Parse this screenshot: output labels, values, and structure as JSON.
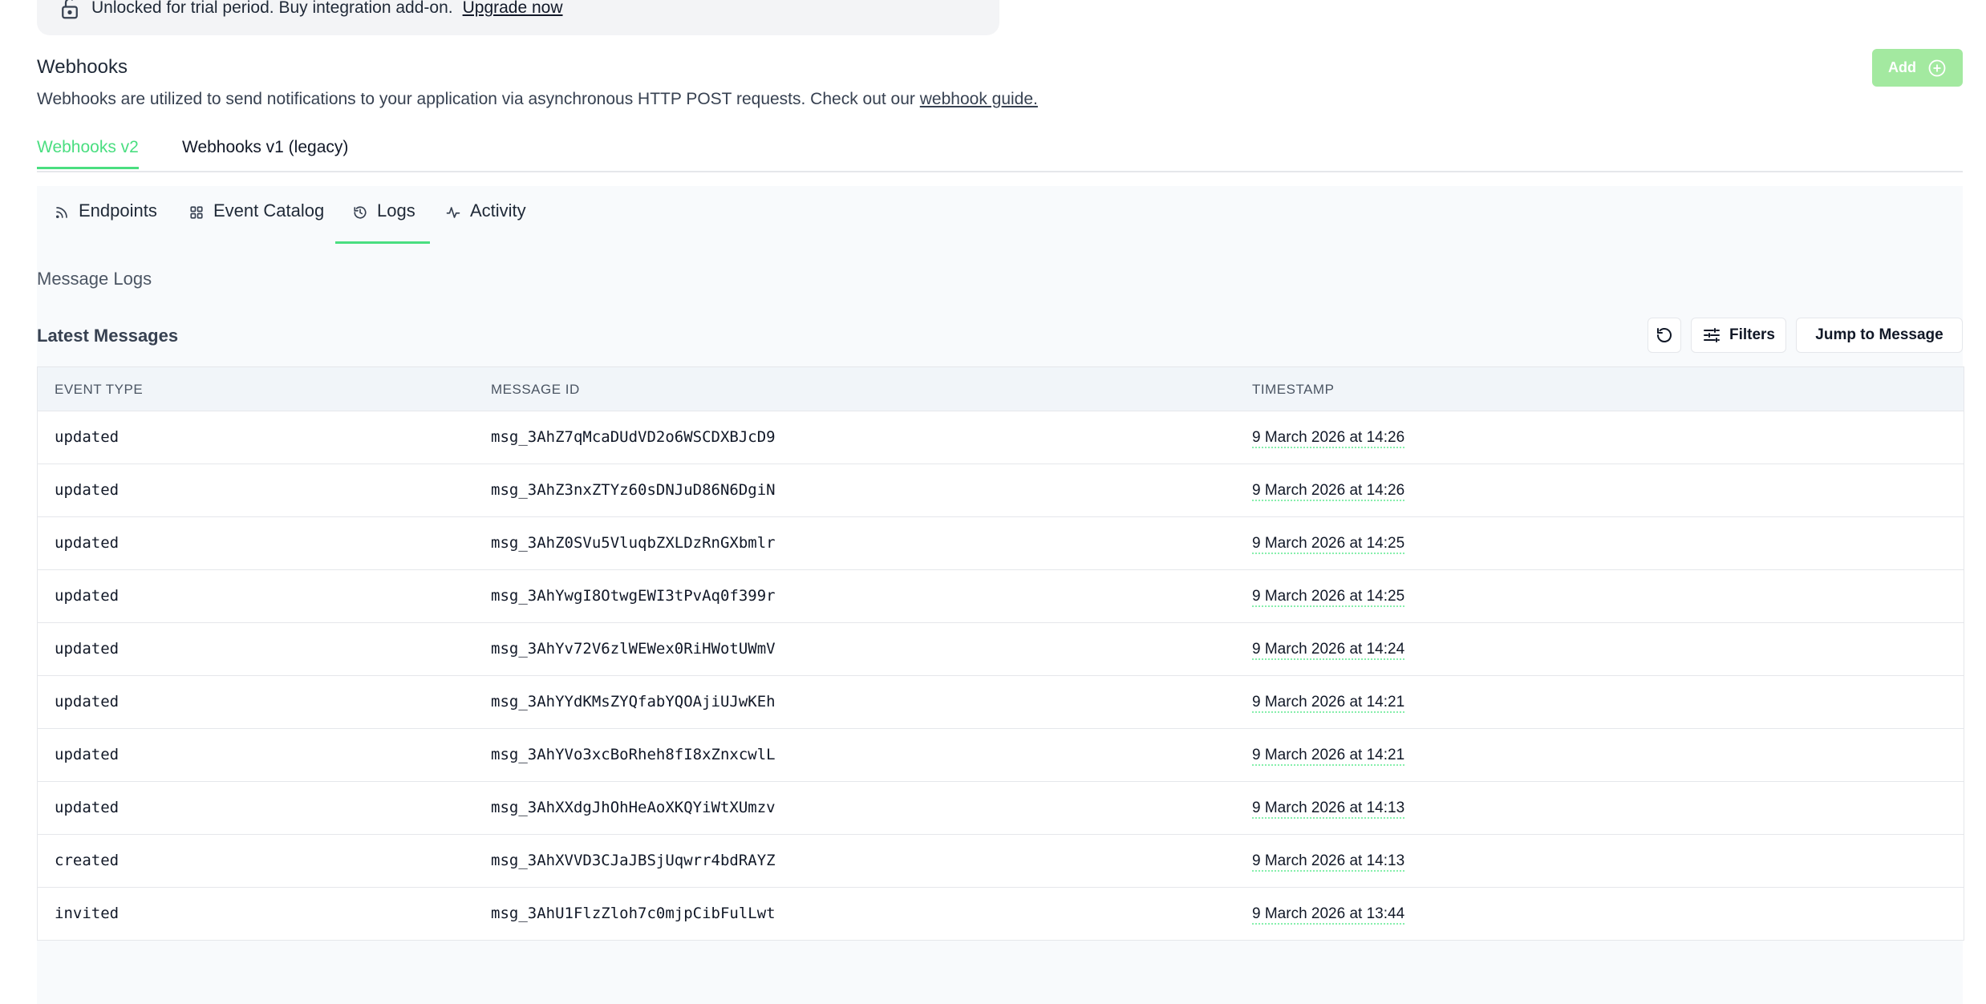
{
  "banner": {
    "text": "Unlocked for trial period. Buy integration add-on.",
    "link": "Upgrade now"
  },
  "section": {
    "title": "Webhooks",
    "description": "Webhooks are utilized to send notifications to your application via asynchronous HTTP POST requests. Check out our",
    "link": "webhook guide.",
    "add_label": "Add"
  },
  "top_tabs": [
    {
      "label": "Webhooks v2",
      "active": true
    },
    {
      "label": "Webhooks v1 (legacy)",
      "active": false
    }
  ],
  "sub_tabs": [
    {
      "label": "Endpoints",
      "icon": "rss-icon"
    },
    {
      "label": "Event Catalog",
      "icon": "grid-icon"
    },
    {
      "label": "Logs",
      "icon": "history-icon",
      "active": true
    },
    {
      "label": "Activity",
      "icon": "activity-icon"
    }
  ],
  "logs": {
    "heading": "Message Logs",
    "latest_title": "Latest Messages",
    "filters_label": "Filters",
    "jump_label": "Jump to Message"
  },
  "table": {
    "headers": [
      "EVENT TYPE",
      "MESSAGE ID",
      "TIMESTAMP"
    ],
    "rows": [
      {
        "event": "updated",
        "id": "msg_3AhZ7qMcaDUdVD2o6WSCDXBJcD9",
        "ts": "9 March 2026 at 14:26"
      },
      {
        "event": "updated",
        "id": "msg_3AhZ3nxZTYz60sDNJuD86N6DgiN",
        "ts": "9 March 2026 at 14:26"
      },
      {
        "event": "updated",
        "id": "msg_3AhZ0SVu5VluqbZXLDzRnGXbmlr",
        "ts": "9 March 2026 at 14:25"
      },
      {
        "event": "updated",
        "id": "msg_3AhYwgI8OtwgEWI3tPvAq0f399r",
        "ts": "9 March 2026 at 14:25"
      },
      {
        "event": "updated",
        "id": "msg_3AhYv72V6zlWEWex0RiHWotUWmV",
        "ts": "9 March 2026 at 14:24"
      },
      {
        "event": "updated",
        "id": "msg_3AhYYdKMsZYQfabYQOAjiUJwKEh",
        "ts": "9 March 2026 at 14:21"
      },
      {
        "event": "updated",
        "id": "msg_3AhYVo3xcBoRheh8fI8xZnxcwlL",
        "ts": "9 March 2026 at 14:21"
      },
      {
        "event": "updated",
        "id": "msg_3AhXXdgJhOhHeAoXKQYiWtXUmzv",
        "ts": "9 March 2026 at 14:13"
      },
      {
        "event": "created",
        "id": "msg_3AhXVVD3CJaJBSjUqwrr4bdRAYZ",
        "ts": "9 March 2026 at 14:13"
      },
      {
        "event": "invited",
        "id": "msg_3AhU1FlzZloh7c0mjpCibFulLwt",
        "ts": "9 March 2026 at 13:44"
      }
    ]
  }
}
